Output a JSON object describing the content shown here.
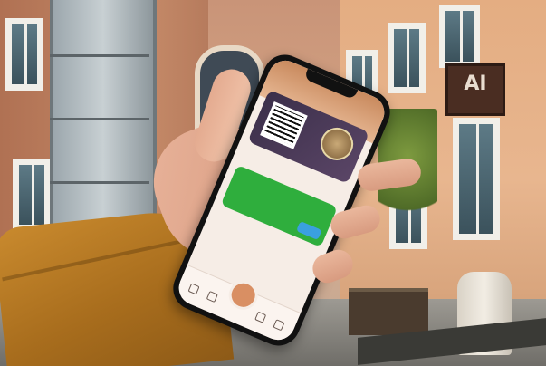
{
  "image": {
    "caption_fragment": "",
    "phone": {
      "section_label": "",
      "card_footer": "",
      "panel_text": ""
    },
    "sign_text": "AI"
  }
}
